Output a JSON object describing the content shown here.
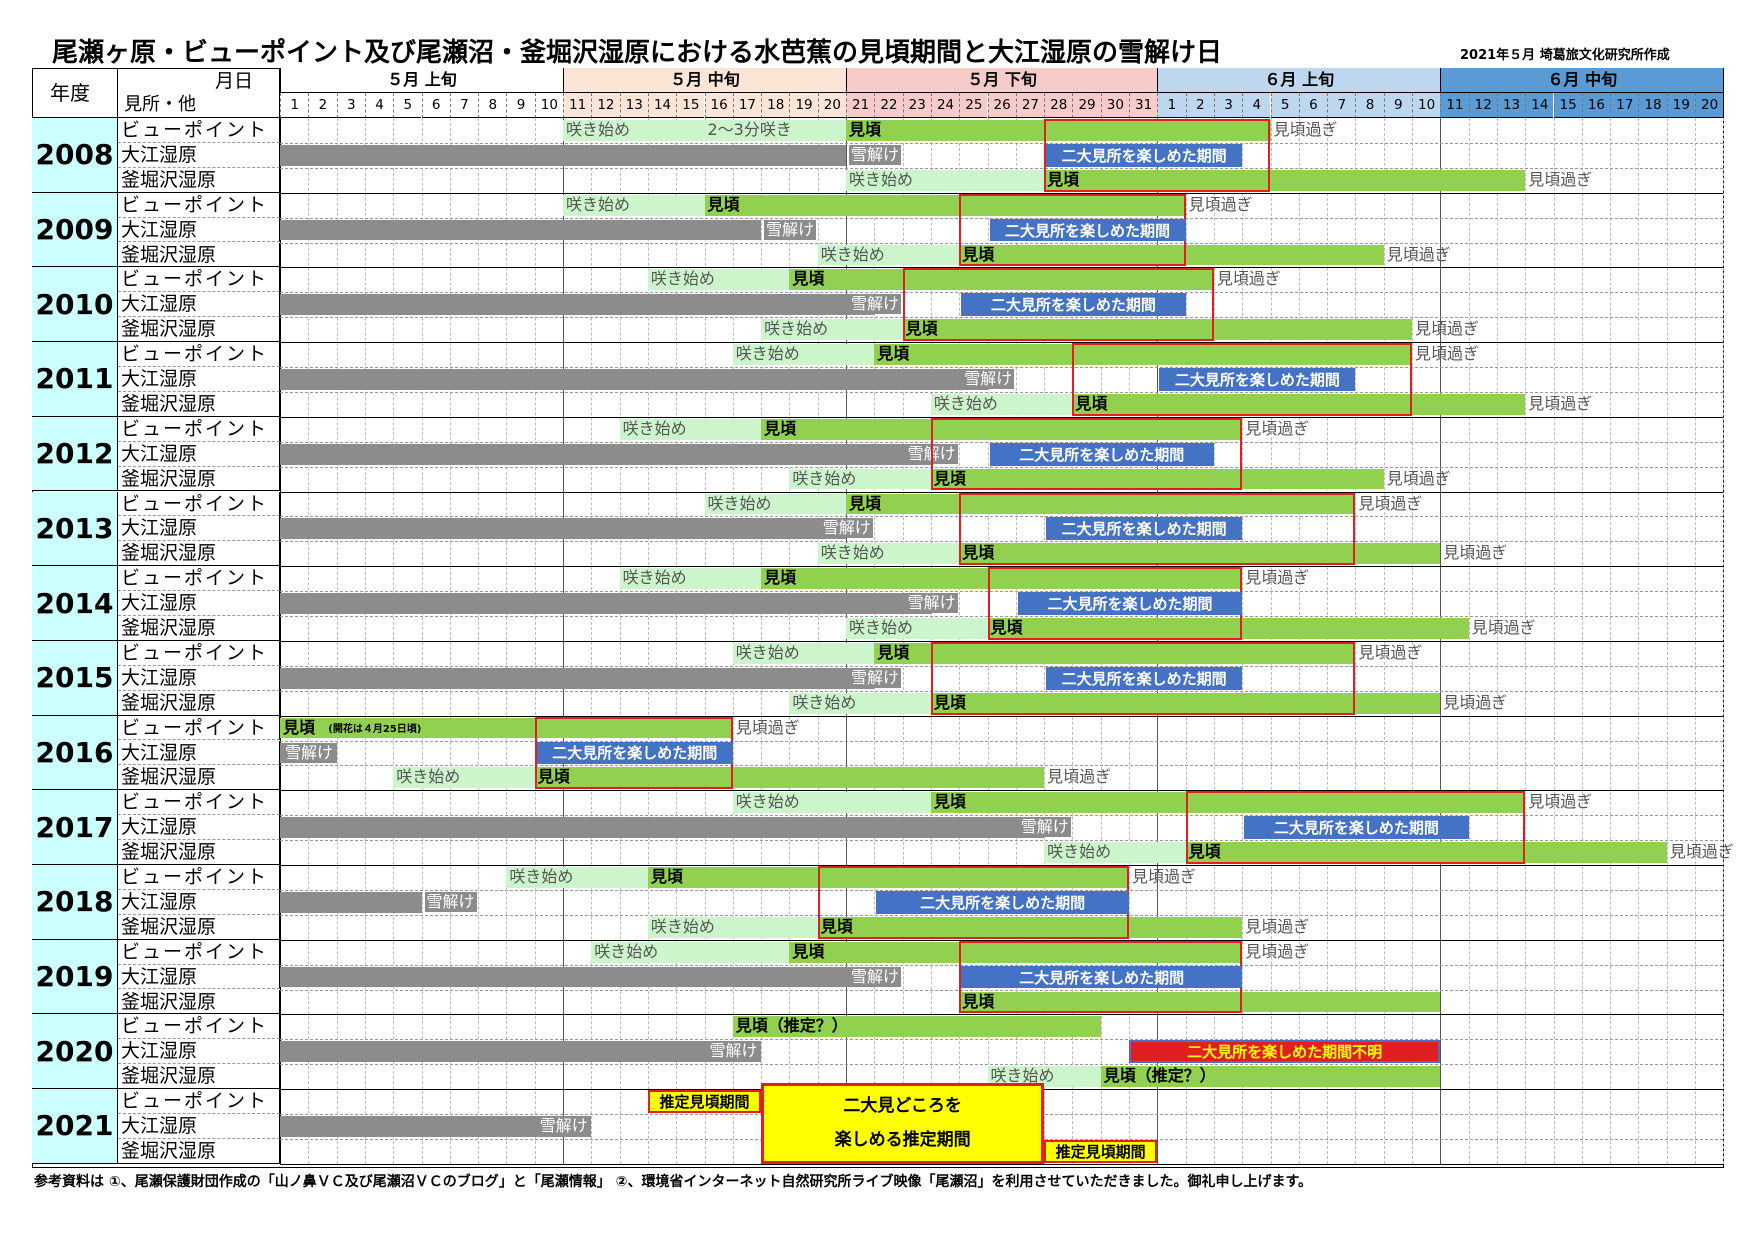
{
  "title": "尾瀬ヶ原・ビューポイント及び尾瀬沼・釜堀沢湿原における水芭蕉の見頃期間と大江湿原の雪解け日",
  "credit": "2021年５月 埼葛旅文化研究所作成",
  "header": {
    "year_label": "年度",
    "month_day_label": "月日",
    "place_label": "見所・他",
    "bands": [
      {
        "label": "５月 上旬",
        "color": "#ffffff",
        "start": 0,
        "days": 10
      },
      {
        "label": "５月 中旬",
        "color": "#fbe5d6",
        "start": 10,
        "days": 10
      },
      {
        "label": "５月 下旬",
        "color": "#f8cbcb",
        "start": 20,
        "days": 11
      },
      {
        "label": "６月 上旬",
        "color": "#bdd7ee",
        "start": 31,
        "days": 10
      },
      {
        "label": "６月 中旬",
        "color": "#5b9bd5",
        "start": 41,
        "days": 10
      }
    ],
    "days": [
      "1",
      "2",
      "3",
      "4",
      "5",
      "6",
      "7",
      "8",
      "9",
      "10",
      "11",
      "12",
      "13",
      "14",
      "15",
      "16",
      "17",
      "18",
      "19",
      "20",
      "21",
      "22",
      "23",
      "24",
      "25",
      "26",
      "27",
      "28",
      "29",
      "30",
      "31",
      "1",
      "2",
      "3",
      "4",
      "5",
      "6",
      "7",
      "8",
      "9",
      "10",
      "11",
      "12",
      "13",
      "14",
      "15",
      "16",
      "17",
      "18",
      "19",
      "20"
    ]
  },
  "row_labels": [
    "ビューポイント",
    "大江湿原",
    "釜堀沢湿原"
  ],
  "colors": {
    "light_green": "#ccf5cc",
    "green": "#92d050",
    "gray": "#8c8c8c",
    "blue": "#4472c4",
    "red": "#e02020",
    "yellow": "#ffff00",
    "year_bg": "#ccffff"
  },
  "labels": {
    "bloom": "咲き始め",
    "peak": "見頃",
    "past": "見頃過ぎ",
    "snow": "雪解け",
    "both": "二大見所を楽しめた期間",
    "unknown": "二大見所を楽しめた期間不明",
    "est_peak": "推定見頃期間",
    "est_both_line1": "二大見どころを",
    "est_both_line2": "楽しめる推定期間",
    "partial_2008": "2〜3分咲き",
    "peak_2016_note": "(開花は４月25日頃)",
    "peak_est": "見頃（推定？）"
  },
  "years": [
    {
      "year": "2008",
      "view": {
        "bloom": [
          10,
          14
        ],
        "partial": [
          15,
          19
        ],
        "peak": [
          20,
          34
        ],
        "past_label": 35
      },
      "snow": {
        "gray": [
          0,
          19
        ],
        "snow_label": 20
      },
      "kama": {
        "bloom": [
          20,
          26
        ],
        "peak": [
          27,
          43
        ],
        "past_label": 44
      },
      "both": {
        "box": [
          27,
          34
        ],
        "callout": [
          27,
          33
        ]
      }
    },
    {
      "year": "2009",
      "view": {
        "bloom": [
          10,
          14
        ],
        "peak": [
          15,
          31
        ],
        "past_label": 32
      },
      "snow": {
        "gray": [
          0,
          16
        ],
        "snow_label": 17
      },
      "kama": {
        "bloom": [
          19,
          23
        ],
        "peak": [
          24,
          38
        ],
        "past_label": 39
      },
      "both": {
        "box": [
          24,
          31
        ],
        "callout": [
          25,
          31
        ]
      }
    },
    {
      "year": "2010",
      "view": {
        "bloom": [
          13,
          17
        ],
        "peak": [
          18,
          32
        ],
        "past_label": 33
      },
      "snow": {
        "gray": [
          0,
          20
        ],
        "snow_label": 20
      },
      "kama": {
        "bloom": [
          17,
          21
        ],
        "peak": [
          22,
          39
        ],
        "past_label": 40
      },
      "both": {
        "box": [
          22,
          32
        ],
        "callout": [
          24,
          31
        ]
      }
    },
    {
      "year": "2011",
      "view": {
        "bloom": [
          16,
          20
        ],
        "peak": [
          21,
          39
        ],
        "past_label": 40
      },
      "snow": {
        "gray": [
          0,
          24
        ],
        "snow_label": 24
      },
      "kama": {
        "bloom": [
          23,
          27
        ],
        "peak": [
          28,
          43
        ],
        "past_label": 44
      },
      "both": {
        "box": [
          28,
          39
        ],
        "callout": [
          31,
          37
        ]
      }
    },
    {
      "year": "2012",
      "view": {
        "bloom": [
          12,
          16
        ],
        "peak": [
          17,
          33
        ],
        "past_label": 34
      },
      "snow": {
        "gray": [
          0,
          22
        ],
        "snow_label": 22
      },
      "kama": {
        "bloom": [
          18,
          22
        ],
        "peak": [
          23,
          38
        ],
        "past_label": 39
      },
      "both": {
        "box": [
          23,
          33
        ],
        "callout": [
          25,
          32
        ]
      }
    },
    {
      "year": "2013",
      "view": {
        "bloom": [
          15,
          19
        ],
        "peak": [
          20,
          37
        ],
        "past_label": 38
      },
      "snow": {
        "gray": [
          0,
          19
        ],
        "snow_label": 19
      },
      "kama": {
        "bloom": [
          19,
          23
        ],
        "peak": [
          24,
          40
        ],
        "past_label": 41
      },
      "both": {
        "box": [
          24,
          37
        ],
        "callout": [
          27,
          33
        ]
      }
    },
    {
      "year": "2014",
      "view": {
        "bloom": [
          12,
          16
        ],
        "peak": [
          17,
          33
        ],
        "past_label": 34
      },
      "snow": {
        "gray": [
          0,
          22
        ],
        "snow_label": 22
      },
      "kama": {
        "bloom": [
          20,
          24
        ],
        "peak": [
          25,
          41
        ],
        "past_label": 42
      },
      "both": {
        "box": [
          25,
          33
        ],
        "callout": [
          26,
          33
        ]
      }
    },
    {
      "year": "2015",
      "view": {
        "bloom": [
          16,
          20
        ],
        "peak": [
          21,
          37
        ],
        "past_label": 38
      },
      "snow": {
        "gray": [
          0,
          20
        ],
        "snow_label": 20
      },
      "kama": {
        "bloom": [
          18,
          22
        ],
        "peak": [
          23,
          40
        ],
        "past_label": 41
      },
      "both": {
        "box": [
          23,
          37
        ],
        "callout": [
          27,
          33
        ]
      }
    },
    {
      "year": "2016",
      "view": {
        "peak": [
          0,
          15
        ],
        "past_label": 16,
        "peak_note": true
      },
      "snow": {
        "gray": [
          0,
          1
        ],
        "snow_label": 0
      },
      "kama": {
        "bloom": [
          4,
          8
        ],
        "peak": [
          9,
          26
        ],
        "past_label": 27
      },
      "both": {
        "box": [
          9,
          15
        ],
        "callout": [
          9,
          15
        ]
      }
    },
    {
      "year": "2017",
      "view": {
        "bloom": [
          16,
          22
        ],
        "peak": [
          23,
          43
        ],
        "past_label": 44
      },
      "snow": {
        "gray": [
          0,
          26
        ],
        "snow_label": 26
      },
      "kama": {
        "bloom": [
          27,
          31
        ],
        "peak": [
          32,
          48
        ],
        "past_label": 49
      },
      "both": {
        "box": [
          32,
          43
        ],
        "callout": [
          34,
          41
        ]
      }
    },
    {
      "year": "2018",
      "view": {
        "bloom": [
          8,
          12
        ],
        "peak": [
          13,
          29
        ],
        "past_label": 30
      },
      "snow": {
        "gray": [
          0,
          4
        ],
        "snow_label": 5
      },
      "kama": {
        "bloom": [
          13,
          18
        ],
        "peak": [
          19,
          33
        ],
        "past_label": 34
      },
      "both": {
        "box": [
          19,
          29
        ],
        "callout": [
          21,
          29
        ]
      }
    },
    {
      "year": "2019",
      "view": {
        "bloom": [
          11,
          17
        ],
        "peak": [
          18,
          33
        ],
        "past_label": 34
      },
      "snow": {
        "gray": [
          0,
          20
        ],
        "snow_label": 20
      },
      "kama": {
        "peak": [
          24,
          40
        ]
      },
      "both": {
        "box": [
          24,
          33
        ],
        "callout": [
          24,
          33
        ]
      }
    },
    {
      "year": "2020",
      "view": {
        "peak_est": [
          16,
          28
        ]
      },
      "snow": {
        "gray": [
          0,
          16
        ],
        "snow_label": 15
      },
      "kama": {
        "bloom": [
          25,
          28
        ],
        "peak_est": [
          29,
          40
        ]
      },
      "unknown_callout": [
        30,
        40
      ]
    },
    {
      "year": "2021",
      "estimated": true,
      "snow": {
        "gray": [
          0,
          10
        ],
        "snow_label": 9
      },
      "est_view": [
        13,
        16
      ],
      "est_both": [
        17,
        26
      ],
      "est_kama": [
        27,
        30
      ]
    }
  ],
  "footer": "参考資料は ①、尾瀬保護財団作成の「山ノ鼻ＶＣ及び尾瀬沼ＶＣのブログ」と「尾瀬情報」 ②、環境省インターネット自然研究所ライブ映像「尾瀬沼」を利用させていただきました。御礼申し上げます。"
}
